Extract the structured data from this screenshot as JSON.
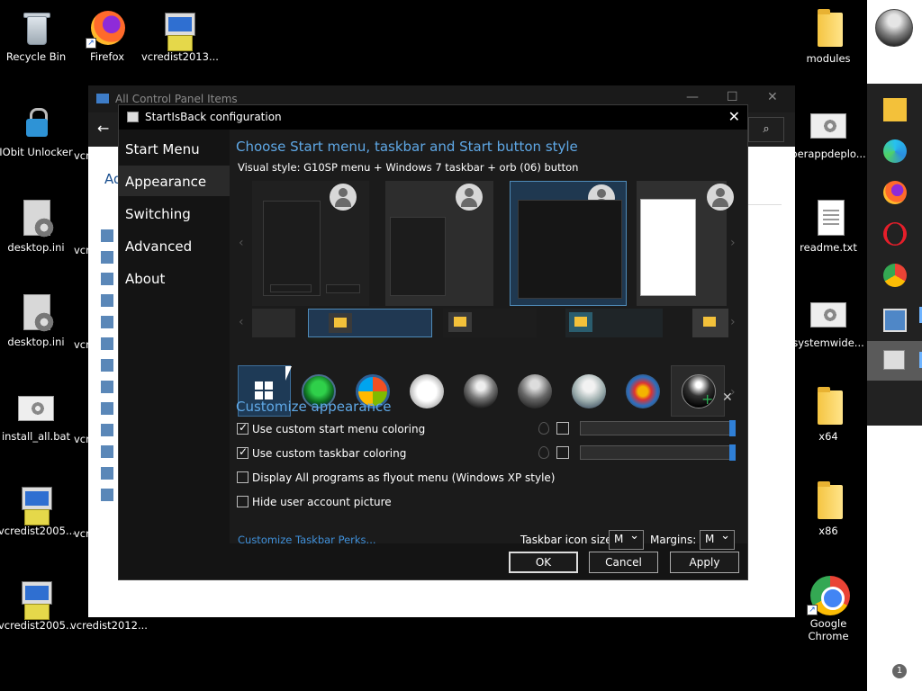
{
  "desktop": {
    "left_icons": [
      {
        "label": "Recycle Bin"
      },
      {
        "label": "Firefox"
      },
      {
        "label": "vcredist2013..."
      },
      {
        "label": "IObit Unlocker"
      },
      {
        "label": "desktop.ini"
      },
      {
        "label": "desktop.ini"
      },
      {
        "label": "install_all.bat"
      },
      {
        "label": "vcredist2005..."
      },
      {
        "label": "vcredist2005..."
      },
      {
        "label": "vcredist2012..."
      }
    ],
    "partial_labels": [
      "vcr",
      "vcr",
      "vcr",
      "vcr",
      "vcr",
      "vcr"
    ],
    "right_icons": [
      {
        "label": "modules"
      },
      {
        "label": "perappdeplo..."
      },
      {
        "label": "readme.txt"
      },
      {
        "label": "systemwide..."
      },
      {
        "label": "x64"
      },
      {
        "label": "x86"
      },
      {
        "label": "Google Chrome"
      }
    ]
  },
  "control_panel": {
    "title": "All Control Panel Items",
    "heading_partial": "Ad",
    "back_icon": "back-arrow-icon",
    "search_icon": "search-icon"
  },
  "taskbar": {
    "notification_count": "1",
    "apps": [
      "file-explorer",
      "edge",
      "firefox",
      "opera",
      "chrome",
      "control-panel",
      "startisback"
    ]
  },
  "dialog": {
    "title": "StartIsBack configuration",
    "nav": [
      "Start Menu",
      "Appearance",
      "Switching",
      "Advanced",
      "About"
    ],
    "selected_nav": "Appearance",
    "heading": "Choose Start menu, taskbar and Start button style",
    "visual_style": "Visual style:  G10SP menu + Windows 7 taskbar + orb (06) button",
    "customize_heading": "Customize appearance",
    "options": [
      {
        "label": "Use custom start menu coloring",
        "checked": true
      },
      {
        "label": "Use custom taskbar coloring",
        "checked": true
      },
      {
        "label": "Display All programs as flyout menu (Windows XP style)",
        "checked": false
      },
      {
        "label": "Hide user account picture",
        "checked": false
      }
    ],
    "perks_link": "Customize Taskbar Perks...",
    "icon_size_label": "Taskbar icon size:",
    "icon_size_value": "M",
    "margins_label": "Margins:",
    "margins_value": "M",
    "buttons": {
      "ok": "OK",
      "cancel": "Cancel",
      "apply": "Apply"
    },
    "colors": {
      "accent": "#5fa8e6",
      "link": "#3f8fd8",
      "slider": "#2f7fd6"
    }
  }
}
